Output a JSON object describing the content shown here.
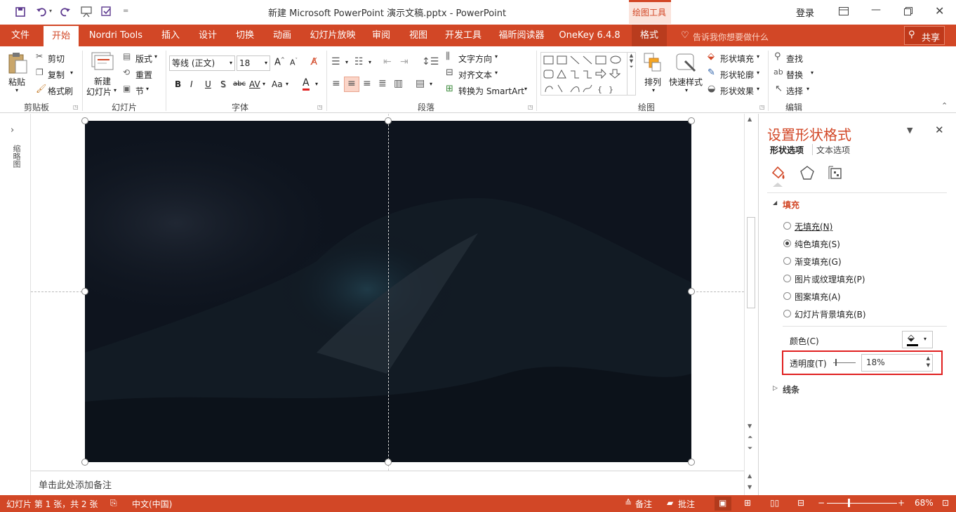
{
  "titlebar": {
    "title": "新建 Microsoft PowerPoint 演示文稿.pptx  -  PowerPoint",
    "context_tab": "绘图工具",
    "login": "登录"
  },
  "tabs": [
    "文件",
    "开始",
    "Nordri Tools",
    "插入",
    "设计",
    "切换",
    "动画",
    "幻灯片放映",
    "审阅",
    "视图",
    "开发工具",
    "福昕阅读器",
    "OneKey 6.4.8",
    "格式"
  ],
  "tell_me": "告诉我你想要做什么",
  "share": "共享",
  "ribbon": {
    "clipboard": {
      "label": "剪贴板",
      "paste": "粘贴",
      "cut": "剪切",
      "copy": "复制",
      "format_painter": "格式刷"
    },
    "slides": {
      "label": "幻灯片",
      "new_slide_line1": "新建",
      "new_slide_line2": "幻灯片",
      "layout": "版式",
      "reset": "重置",
      "section": "节"
    },
    "font": {
      "label": "字体",
      "font_name": "等线 (正文)",
      "font_size": "18",
      "bold": "B",
      "italic": "I",
      "underline": "U",
      "shadow": "S",
      "strike": "abc",
      "spacing": "AV",
      "case": "Aa",
      "color_a": "A"
    },
    "paragraph": {
      "label": "段落",
      "text_direction": "文字方向",
      "align_text": "对齐文本",
      "convert_smartart": "转换为 SmartArt"
    },
    "drawing": {
      "label": "绘图",
      "arrange": "排列",
      "quick_styles": "快速样式",
      "shape_fill": "形状填充",
      "shape_outline": "形状轮廓",
      "shape_effects": "形状效果"
    },
    "editing": {
      "label": "编辑",
      "find": "查找",
      "replace": "替换",
      "select": "选择"
    }
  },
  "left_pane": {
    "thumbnails_label": "缩略图"
  },
  "notes": {
    "placeholder": "单击此处添加备注"
  },
  "panel": {
    "title": "设置形状格式",
    "tab_shape": "形状选项",
    "tab_text": "文本选项",
    "fill_section": "填充",
    "fill_options": [
      {
        "label": "无填充(N)",
        "selected": false
      },
      {
        "label": "纯色填充(S)",
        "selected": true
      },
      {
        "label": "渐变填充(G)",
        "selected": false
      },
      {
        "label": "图片或纹理填充(P)",
        "selected": false
      },
      {
        "label": "图案填充(A)",
        "selected": false
      },
      {
        "label": "幻灯片背景填充(B)",
        "selected": false
      }
    ],
    "color_label": "颜色(C)",
    "transparency_label": "透明度(T)",
    "transparency_value": "18%",
    "line_section": "线条",
    "highlight_color": "#e02020"
  },
  "status": {
    "slide_info": "幻灯片 第 1 张，共 2 张",
    "language": "中文(中国)",
    "notes_btn": "备注",
    "comments_btn": "批注",
    "zoom": "68%"
  },
  "colors": {
    "accent": "#d24726",
    "slide_bg": "#0d131d"
  }
}
